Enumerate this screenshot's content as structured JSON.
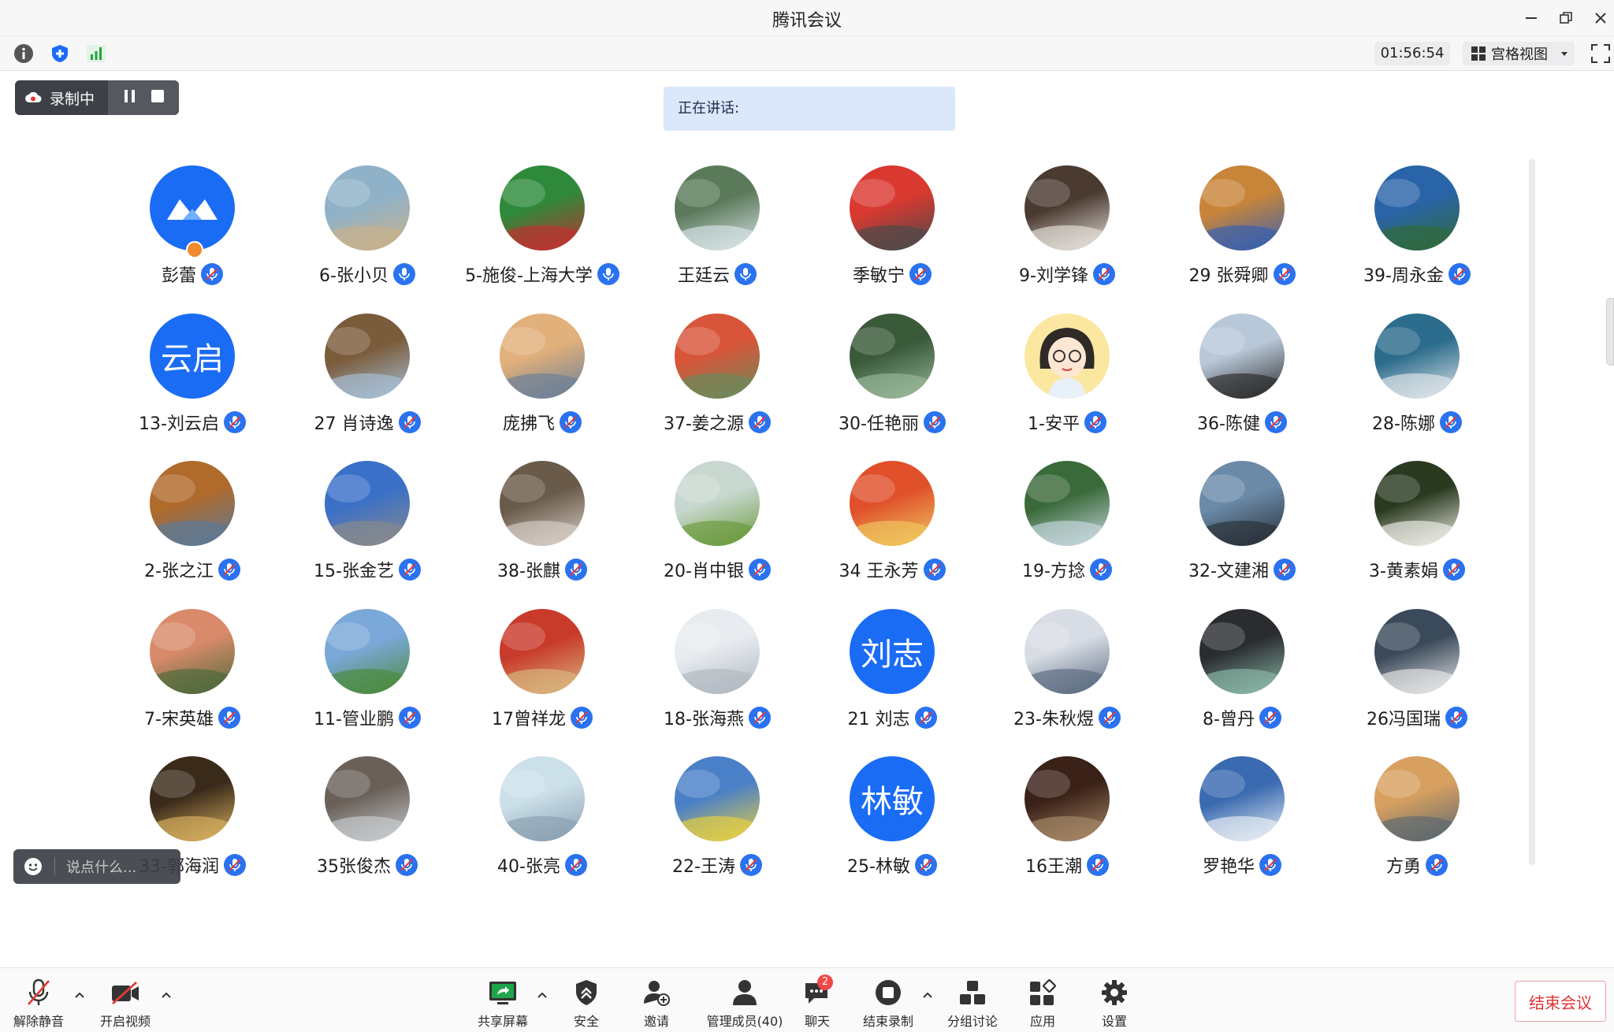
{
  "app": {
    "title": "腾讯会议"
  },
  "infobar": {
    "timer": "01:56:54",
    "view_label": "宫格视图"
  },
  "recording": {
    "label": "录制中"
  },
  "speaking": {
    "label": "正在讲话:"
  },
  "chat_quick": {
    "placeholder": "说点什么..."
  },
  "colors": {
    "accent": "#1a6cf5",
    "mic_blue": "#2a72f0",
    "end_red": "#e03434",
    "recording_bg": "#3d4046"
  },
  "participants": [
    {
      "name": "彭蕾",
      "avatar_kind": "logo",
      "host": true,
      "bg": "#1a6cf5"
    },
    {
      "name": "6-张小贝",
      "bg": "#8fb2c9",
      "bg2": "#c9b18a"
    },
    {
      "name": "5-施俊-上海大学",
      "bg": "#2e8a3a",
      "bg2": "#c23030"
    },
    {
      "name": "王廷云",
      "bg": "#5b7a5a",
      "bg2": "#d8e3e8"
    },
    {
      "name": "季敏宁",
      "bg": "#d9392f",
      "bg2": "#4a4a4a"
    },
    {
      "name": "9-刘学锋",
      "bg": "#4a3a30",
      "bg2": "#e7e2dc"
    },
    {
      "name": "29 张舜卿",
      "bg": "#c8853a",
      "bg2": "#3560b0"
    },
    {
      "name": "39-周永金",
      "bg": "#2a64a8",
      "bg2": "#2f6a3a"
    },
    {
      "name": "13-刘云启",
      "avatar_text": "云启",
      "bg": "#1a6cf5"
    },
    {
      "name": "27 肖诗逸",
      "bg": "#7a5b3a",
      "bg2": "#a8c0d8"
    },
    {
      "name": "庞拂飞",
      "bg": "#e2b07a",
      "bg2": "#6a7f98"
    },
    {
      "name": "37-姜之源",
      "bg": "#d8553a",
      "bg2": "#6a8a5a"
    },
    {
      "name": "30-任艳丽",
      "bg": "#3a5a3a",
      "bg2": "#9ab89a"
    },
    {
      "name": "1-安平",
      "avatar_kind": "cartoon",
      "bg": "#fbe7a0",
      "bg2": "#2f2a28"
    },
    {
      "name": "36-陈健",
      "bg": "#b8c8d8",
      "bg2": "#2a2a2a"
    },
    {
      "name": "28-陈娜",
      "bg": "#2c6c8c",
      "bg2": "#e0e6ea"
    },
    {
      "name": "2-张之江",
      "bg": "#b06a2a",
      "bg2": "#5a7a9a"
    },
    {
      "name": "15-张金艺",
      "bg": "#3a70c8",
      "bg2": "#8a8a8a"
    },
    {
      "name": "38-张麒",
      "bg": "#6a5a4a",
      "bg2": "#d8d0c8"
    },
    {
      "name": "20-肖中银",
      "bg": "#c8d8d0",
      "bg2": "#6a9a3a"
    },
    {
      "name": "34 王永芳",
      "bg": "#e0502a",
      "bg2": "#f0c860"
    },
    {
      "name": "19-方捻",
      "bg": "#3a6a3a",
      "bg2": "#c8d8e0"
    },
    {
      "name": "32-文建湘",
      "bg": "#6a8aa8",
      "bg2": "#2a3038"
    },
    {
      "name": "3-黄素娟",
      "bg": "#2a3a20",
      "bg2": "#f0f0e8"
    },
    {
      "name": "7-宋英雄",
      "bg": "#d88a6a",
      "bg2": "#4a6a3a"
    },
    {
      "name": "11-管业鹏",
      "bg": "#7aa8d8",
      "bg2": "#4a8a3a"
    },
    {
      "name": "17曾祥龙",
      "bg": "#c83a2a",
      "bg2": "#d8b880"
    },
    {
      "name": "18-张海燕",
      "bg": "#e8ecf0",
      "bg2": "#b0b8c0"
    },
    {
      "name": "21 刘志",
      "avatar_text": "刘志",
      "bg": "#1a6cf5"
    },
    {
      "name": "23-朱秋煜",
      "bg": "#d8dde5",
      "bg2": "#5a6a80"
    },
    {
      "name": "8-曾丹",
      "bg": "#2a2c30",
      "bg2": "#8ab8a8"
    },
    {
      "name": "26冯国瑞",
      "bg": "#3a4a5a",
      "bg2": "#e8e8e8"
    },
    {
      "name": "33-郭海润",
      "bg": "#3a2a1a",
      "bg2": "#d8b060"
    },
    {
      "name": "35张俊杰",
      "bg": "#6a6058",
      "bg2": "#c8ccd0"
    },
    {
      "name": "40-张亮",
      "bg": "#cce0ea",
      "bg2": "#8aa0b0"
    },
    {
      "name": "22-王涛",
      "bg": "#4a80c8",
      "bg2": "#e8d040"
    },
    {
      "name": "25-林敏",
      "avatar_text": "林敏",
      "bg": "#1a6cf5"
    },
    {
      "name": "16王潮",
      "bg": "#3a2218",
      "bg2": "#a88868"
    },
    {
      "name": "罗艳华",
      "bg": "#3a6ab0",
      "bg2": "#e8eef5"
    },
    {
      "name": "方勇",
      "bg": "#d8a060",
      "bg2": "#5a6870"
    }
  ],
  "toolbar": {
    "unmute": "解除静音",
    "start_video": "开启视频",
    "share_screen": "共享屏幕",
    "security": "安全",
    "invite": "邀请",
    "manage_members": "管理成员(40)",
    "chat": "聊天",
    "chat_badge": "2",
    "stop_recording": "结束录制",
    "breakout": "分组讨论",
    "apps": "应用",
    "settings": "设置",
    "end_meeting": "结束会议"
  }
}
